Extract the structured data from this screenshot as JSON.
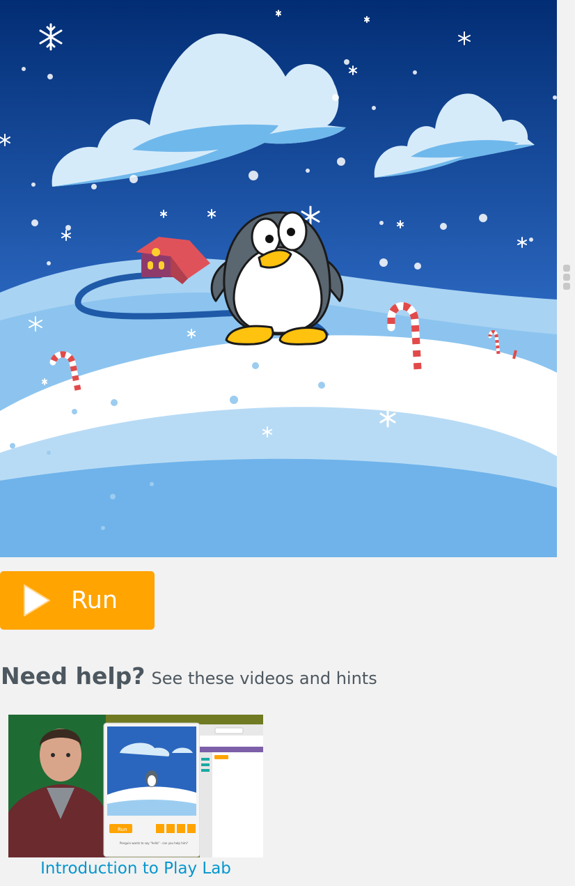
{
  "run_button": {
    "label": "Run"
  },
  "help": {
    "heading": "Need help?",
    "subheading": "See these videos and hints"
  },
  "video": {
    "title": "Introduction to Play Lab",
    "thumb_run_label": "Run",
    "thumb_prompt": "Penguin wants to say \"hello\" - can you help him?"
  },
  "colors": {
    "run_button": "#ffa400",
    "link": "#0596ce",
    "heading": "#4d575f",
    "sky_top": "#022d74",
    "sky_bottom": "#2f74c8"
  },
  "icons": [
    "play-icon",
    "penguin-sprite",
    "snowflake-icon",
    "candy-cane",
    "cloud",
    "house"
  ]
}
